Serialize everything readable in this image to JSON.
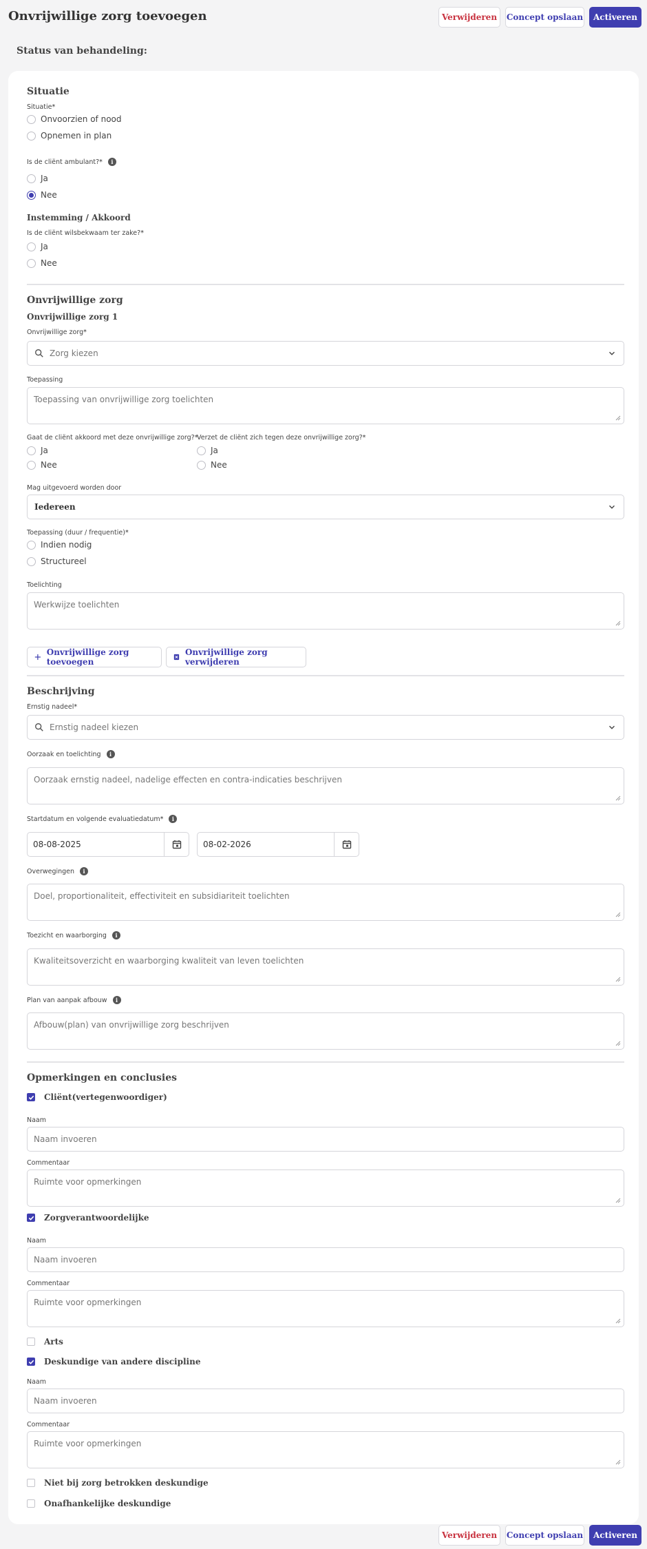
{
  "header": {
    "title": "Onvrijwillige zorg toevoegen",
    "delete_label": "Verwijderen",
    "concept_label": "Concept opslaan",
    "activate_label": "Activeren"
  },
  "status_title": "Status van behandeling:",
  "situatie": {
    "heading": "Situatie",
    "situatie_label": "Situatie",
    "options": [
      "Onvoorzien of nood",
      "Opnemen in plan"
    ],
    "ambulant_label": "Is de cliënt ambulant?",
    "ambulant_options": [
      "Ja",
      "Nee"
    ],
    "ambulant_selected": "Nee",
    "instemming_heading": "Instemming / Akkoord",
    "wilsbekwaam_label": "Is de cliënt wilsbekwaam ter zake?",
    "wilsbekwaam_options": [
      "Ja",
      "Nee"
    ]
  },
  "ovz": {
    "heading": "Onvrijwillige zorg",
    "subheading": "Onvrijwillige zorg 1",
    "zorg_label": "Onvrijwillige zorg",
    "zorg_placeholder": "Zorg kiezen",
    "toepassing_label": "Toepassing",
    "toepassing_placeholder": "Toepassing van onvrijwillige zorg toelichten",
    "akkoord_label": "Gaat de cliënt akkoord met deze onvrijwillige zorg?",
    "verzet_label": "Verzet de cliënt zich tegen deze onvrijwillige zorg?",
    "yes": "Ja",
    "no": "Nee",
    "uitgevoerd_label": "Mag uitgevoerd worden door",
    "uitgevoerd_value": "Iedereen",
    "frequentie_label": "Toepassing (duur / frequentie)",
    "frequentie_options": [
      "Indien nodig",
      "Structureel"
    ],
    "toelichting_label": "Toelichting",
    "toelichting_placeholder": "Werkwijze toelichten",
    "add_label": "Onvrijwillige zorg toevoegen",
    "remove_label": "Onvrijwillige zorg verwijderen"
  },
  "beschrijving": {
    "heading": "Beschrijving",
    "nadeel_label": "Ernstig nadeel",
    "nadeel_placeholder": "Ernstig nadeel kiezen",
    "oorzaak_label": "Oorzaak en toelichting",
    "oorzaak_placeholder": "Oorzaak ernstig nadeel, nadelige effecten en contra-indicaties beschrijven",
    "datum_label": "Startdatum en volgende evaluatiedatum",
    "start_date": "08-08-2025",
    "eval_date": "08-02-2026",
    "overwegingen_label": "Overwegingen",
    "overwegingen_placeholder": "Doel, proportionaliteit, effectiviteit en subsidiariteit toelichten",
    "toezicht_label": "Toezicht en waarborging",
    "toezicht_placeholder": "Kwaliteitsoverzicht en waarborging kwaliteit van leven toelichten",
    "plan_label": "Plan van aanpak afbouw",
    "plan_placeholder": "Afbouw(plan) van onvrijwillige zorg beschrijven"
  },
  "opmerkingen": {
    "heading": "Opmerkingen en conclusies",
    "naam_label": "Naam",
    "naam_placeholder": "Naam invoeren",
    "commentaar_label": "Commentaar",
    "commentaar_placeholder": "Ruimte voor opmerkingen",
    "parties": [
      {
        "label": "Cliënt(vertegenwoordiger)",
        "checked": true
      },
      {
        "label": "Zorgverantwoordelijke",
        "checked": true
      },
      {
        "label": "Arts",
        "checked": false
      },
      {
        "label": "Deskundige van andere discipline",
        "checked": true
      },
      {
        "label": "Niet bij zorg betrokken deskundige",
        "checked": false
      },
      {
        "label": "Onafhankelijke deskundige",
        "checked": false
      }
    ]
  },
  "required_mark": "*",
  "info_glyph": "i"
}
